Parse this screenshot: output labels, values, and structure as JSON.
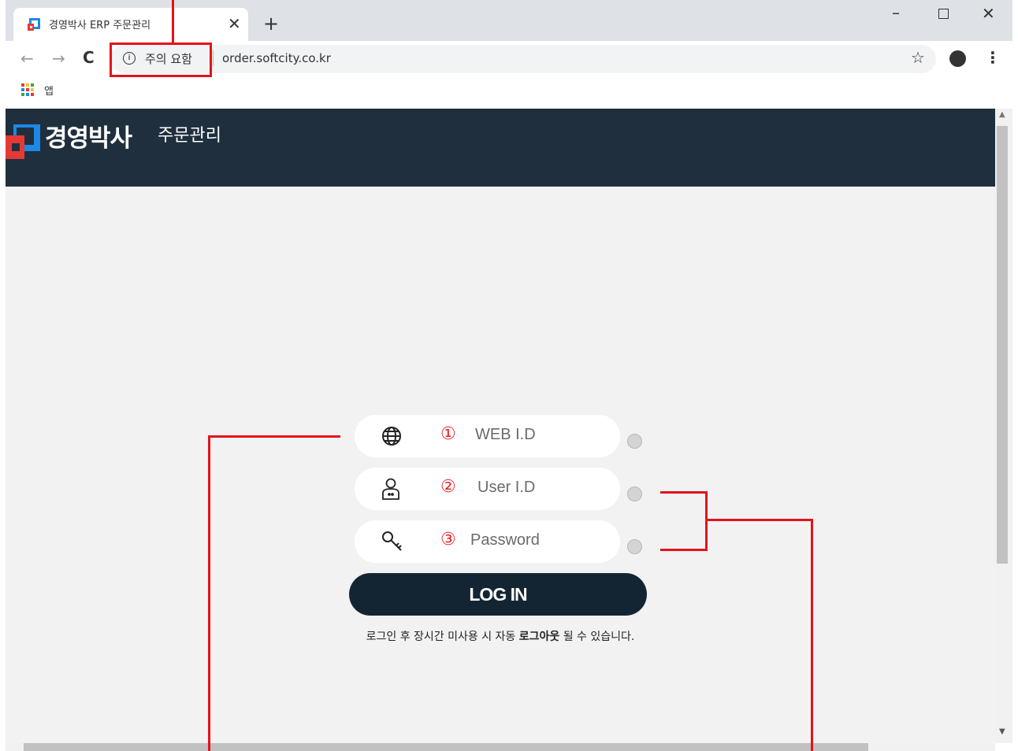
{
  "tab": {
    "title": "경영박사 ERP 주문관리"
  },
  "address_bar": {
    "security_label": "주의 요함",
    "url": "order.softcity.co.kr"
  },
  "bookmarks": {
    "apps_label": "앱"
  },
  "header": {
    "logo_main": "경영박사",
    "logo_sub": "주문관리"
  },
  "login": {
    "fields": [
      {
        "num": "①",
        "placeholder": "WEB I.D",
        "icon": "globe-icon"
      },
      {
        "num": "②",
        "placeholder": "User I.D",
        "icon": "user-icon"
      },
      {
        "num": "③",
        "placeholder": "Password",
        "icon": "key-icon"
      }
    ],
    "button_label": "LOG IN",
    "notice_before": "로그인 후 장시간 미사용 시 자동 ",
    "notice_bold": "로그아웃",
    "notice_after": " 될 수 있습니다."
  },
  "colors": {
    "header_bg": "#1f2f3d",
    "button_bg": "#132533",
    "annotation_red": "#e3131b"
  }
}
